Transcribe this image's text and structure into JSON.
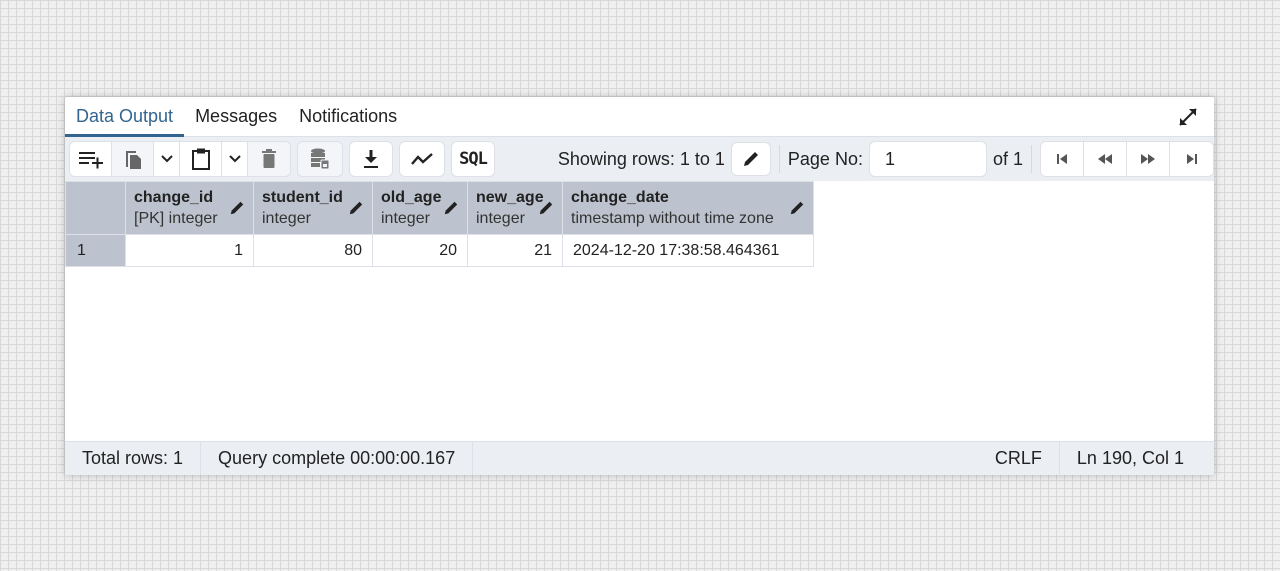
{
  "tabs": [
    {
      "label": "Data Output",
      "active": true
    },
    {
      "label": "Messages",
      "active": false
    },
    {
      "label": "Notifications",
      "active": false
    }
  ],
  "toolbar": {
    "buttons": [
      {
        "name": "add-row",
        "icon": "add-row-icon"
      },
      {
        "name": "copy",
        "icon": "copy-icon"
      },
      {
        "name": "copy-options",
        "icon": "chevron-down-icon"
      },
      {
        "name": "paste",
        "icon": "paste-icon"
      },
      {
        "name": "paste-options",
        "icon": "chevron-down-icon"
      },
      {
        "name": "delete",
        "icon": "trash-icon"
      },
      {
        "name": "save-data",
        "icon": "database-save-icon"
      },
      {
        "name": "download",
        "icon": "download-icon"
      },
      {
        "name": "graph",
        "icon": "line-chart-icon"
      },
      {
        "name": "sql",
        "icon": "sql-icon",
        "label": "SQL"
      }
    ],
    "showing_rows": "Showing rows: 1 to 1",
    "page_label": "Page No:",
    "page_value": "1",
    "of_pages": "of 1"
  },
  "grid": {
    "columns": [
      {
        "name": "change_id",
        "type": "[PK] integer"
      },
      {
        "name": "student_id",
        "type": "integer"
      },
      {
        "name": "old_age",
        "type": "integer"
      },
      {
        "name": "new_age",
        "type": "integer"
      },
      {
        "name": "change_date",
        "type": "timestamp without time zone"
      }
    ],
    "rows": [
      {
        "rownum": "1",
        "cells": [
          "1",
          "80",
          "20",
          "21",
          "2024-12-20 17:38:58.464361"
        ]
      }
    ]
  },
  "status": {
    "total_rows": "Total rows: 1",
    "query": "Query complete 00:00:00.167",
    "eol": "CRLF",
    "position": "Ln 190, Col 1"
  },
  "colors": {
    "accent": "#326690",
    "header_bg": "#bdc3ce",
    "toolbar_bg": "#ebeef3"
  }
}
